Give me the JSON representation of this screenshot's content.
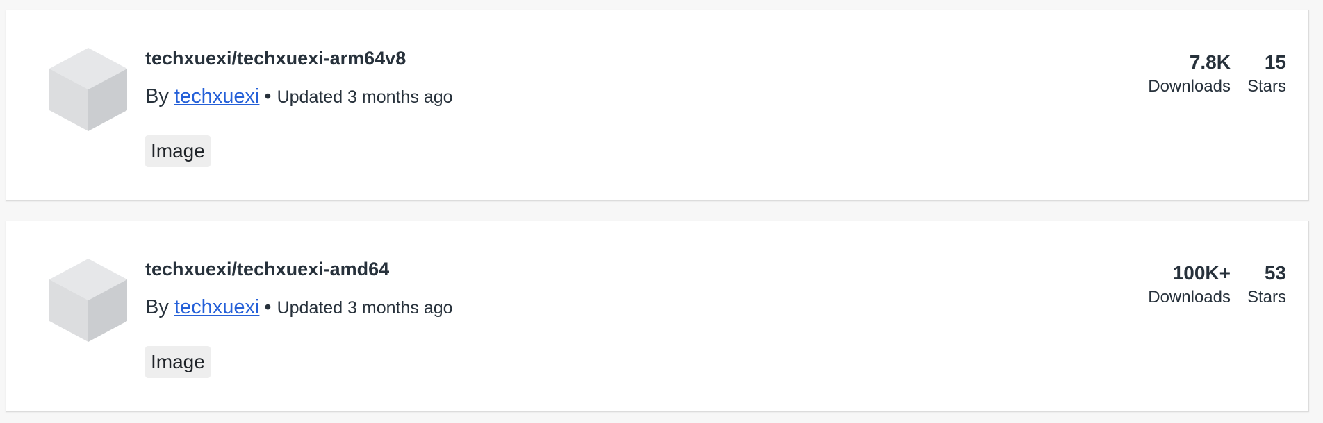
{
  "results": [
    {
      "name": "techxuexi/techxuexi-arm64v8",
      "by_prefix": "By",
      "publisher": "techxuexi",
      "separator": "•",
      "updated": "Updated 3 months ago",
      "tag": "Image",
      "downloads": "7.8K",
      "downloads_label": "Downloads",
      "stars": "15",
      "stars_label": "Stars",
      "icon": "cube-icon"
    },
    {
      "name": "techxuexi/techxuexi-amd64",
      "by_prefix": "By",
      "publisher": "techxuexi",
      "separator": "•",
      "updated": "Updated 3 months ago",
      "tag": "Image",
      "downloads": "100K+",
      "downloads_label": "Downloads",
      "stars": "53",
      "stars_label": "Stars",
      "icon": "cube-icon"
    }
  ],
  "colors": {
    "link": "#2560d8",
    "tag_bg": "#eeeeee",
    "text": "#27313b"
  }
}
